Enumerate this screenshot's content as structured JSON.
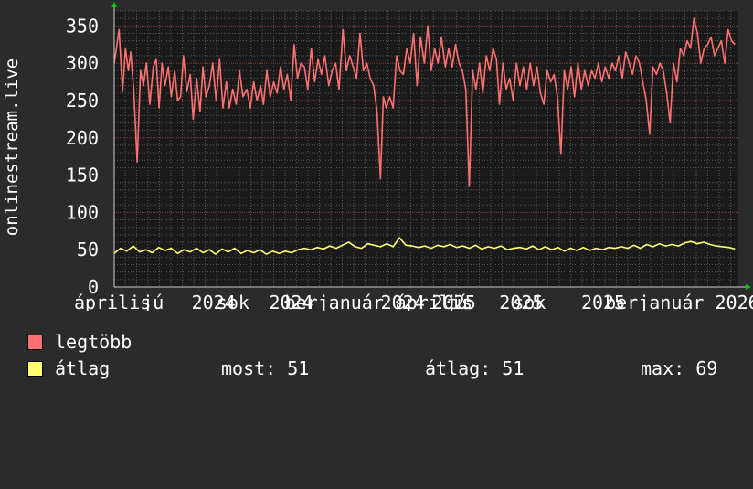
{
  "chart_data": {
    "type": "line",
    "ylabel": "onlinestream.live",
    "ylim": [
      0,
      370
    ],
    "yticks": [
      0,
      50,
      100,
      150,
      200,
      250,
      300,
      350
    ],
    "xticks": [
      {
        "t": 0.0,
        "label": "április"
      },
      {
        "t": 0.139,
        "label": "jú"
      },
      {
        "t": 0.241,
        "label": "2024"
      },
      {
        "t": 0.292,
        "label": "sok"
      },
      {
        "t": 0.4,
        "label": "2024"
      },
      {
        "t": 0.432,
        "label": "berjanuár"
      },
      {
        "t": 0.629,
        "label": "2024"
      },
      {
        "t": 0.659,
        "label": "április"
      },
      {
        "t": 0.734,
        "label": "2025"
      },
      {
        "t": 0.762,
        "label": "jú"
      },
      {
        "t": 0.872,
        "label": "2025"
      },
      {
        "t": 0.9,
        "label": "sok"
      },
      {
        "t": 1.04,
        "label": "2025"
      },
      {
        "t": 1.089,
        "label": "berjanuár 2026"
      }
    ],
    "grid": true,
    "series": [
      {
        "name": "legtöbb",
        "color": "#ff7070",
        "points": [
          [
            0.0,
            300
          ],
          [
            0.01,
            345
          ],
          [
            0.017,
            262
          ],
          [
            0.023,
            320
          ],
          [
            0.029,
            290
          ],
          [
            0.034,
            315
          ],
          [
            0.04,
            265
          ],
          [
            0.047,
            168
          ],
          [
            0.054,
            290
          ],
          [
            0.06,
            270
          ],
          [
            0.066,
            300
          ],
          [
            0.073,
            245
          ],
          [
            0.08,
            295
          ],
          [
            0.086,
            305
          ],
          [
            0.092,
            240
          ],
          [
            0.098,
            300
          ],
          [
            0.104,
            270
          ],
          [
            0.111,
            295
          ],
          [
            0.117,
            255
          ],
          [
            0.124,
            290
          ],
          [
            0.13,
            250
          ],
          [
            0.136,
            255
          ],
          [
            0.142,
            310
          ],
          [
            0.149,
            262
          ],
          [
            0.156,
            285
          ],
          [
            0.162,
            225
          ],
          [
            0.169,
            280
          ],
          [
            0.176,
            235
          ],
          [
            0.182,
            295
          ],
          [
            0.188,
            255
          ],
          [
            0.195,
            270
          ],
          [
            0.202,
            300
          ],
          [
            0.209,
            250
          ],
          [
            0.216,
            305
          ],
          [
            0.223,
            240
          ],
          [
            0.23,
            275
          ],
          [
            0.236,
            240
          ],
          [
            0.243,
            265
          ],
          [
            0.25,
            245
          ],
          [
            0.257,
            290
          ],
          [
            0.264,
            255
          ],
          [
            0.272,
            265
          ],
          [
            0.279,
            240
          ],
          [
            0.286,
            275
          ],
          [
            0.293,
            250
          ],
          [
            0.3,
            270
          ],
          [
            0.306,
            245
          ],
          [
            0.313,
            290
          ],
          [
            0.32,
            255
          ],
          [
            0.327,
            275
          ],
          [
            0.334,
            260
          ],
          [
            0.341,
            295
          ],
          [
            0.348,
            265
          ],
          [
            0.355,
            285
          ],
          [
            0.362,
            250
          ],
          [
            0.369,
            325
          ],
          [
            0.376,
            280
          ],
          [
            0.383,
            300
          ],
          [
            0.39,
            295
          ],
          [
            0.397,
            265
          ],
          [
            0.404,
            320
          ],
          [
            0.411,
            275
          ],
          [
            0.418,
            305
          ],
          [
            0.425,
            285
          ],
          [
            0.432,
            310
          ],
          [
            0.44,
            270
          ],
          [
            0.447,
            290
          ],
          [
            0.454,
            300
          ],
          [
            0.461,
            265
          ],
          [
            0.469,
            345
          ],
          [
            0.476,
            290
          ],
          [
            0.483,
            310
          ],
          [
            0.49,
            295
          ],
          [
            0.497,
            280
          ],
          [
            0.504,
            340
          ],
          [
            0.511,
            290
          ],
          [
            0.518,
            300
          ],
          [
            0.525,
            280
          ],
          [
            0.532,
            270
          ],
          [
            0.539,
            235
          ],
          [
            0.546,
            145
          ],
          [
            0.552,
            255
          ],
          [
            0.558,
            240
          ],
          [
            0.565,
            255
          ],
          [
            0.572,
            240
          ],
          [
            0.579,
            310
          ],
          [
            0.586,
            290
          ],
          [
            0.593,
            285
          ],
          [
            0.6,
            320
          ],
          [
            0.607,
            300
          ],
          [
            0.614,
            340
          ],
          [
            0.621,
            270
          ],
          [
            0.628,
            335
          ],
          [
            0.636,
            300
          ],
          [
            0.643,
            350
          ],
          [
            0.65,
            290
          ],
          [
            0.657,
            320
          ],
          [
            0.664,
            300
          ],
          [
            0.671,
            335
          ],
          [
            0.679,
            295
          ],
          [
            0.686,
            320
          ],
          [
            0.693,
            295
          ],
          [
            0.7,
            325
          ],
          [
            0.707,
            300
          ],
          [
            0.714,
            290
          ],
          [
            0.721,
            265
          ],
          [
            0.728,
            135
          ],
          [
            0.735,
            290
          ],
          [
            0.742,
            265
          ],
          [
            0.749,
            300
          ],
          [
            0.756,
            260
          ],
          [
            0.763,
            310
          ],
          [
            0.77,
            290
          ],
          [
            0.777,
            320
          ],
          [
            0.784,
            305
          ],
          [
            0.79,
            245
          ],
          [
            0.797,
            300
          ],
          [
            0.804,
            265
          ],
          [
            0.811,
            280
          ],
          [
            0.818,
            250
          ],
          [
            0.825,
            300
          ],
          [
            0.832,
            270
          ],
          [
            0.839,
            295
          ],
          [
            0.846,
            265
          ],
          [
            0.853,
            300
          ],
          [
            0.86,
            270
          ],
          [
            0.867,
            295
          ],
          [
            0.874,
            260
          ],
          [
            0.881,
            245
          ],
          [
            0.888,
            290
          ],
          [
            0.895,
            275
          ],
          [
            0.902,
            285
          ],
          [
            0.909,
            255
          ],
          [
            0.916,
            178
          ],
          [
            0.923,
            290
          ],
          [
            0.93,
            265
          ],
          [
            0.937,
            295
          ],
          [
            0.944,
            255
          ],
          [
            0.951,
            300
          ],
          [
            0.958,
            265
          ],
          [
            0.965,
            290
          ],
          [
            0.972,
            270
          ],
          [
            0.979,
            290
          ],
          [
            0.986,
            280
          ],
          [
            0.993,
            300
          ],
          [
            1.0,
            275
          ],
          [
            1.007,
            295
          ],
          [
            1.014,
            280
          ],
          [
            1.021,
            300
          ],
          [
            1.028,
            290
          ],
          [
            1.035,
            310
          ],
          [
            1.042,
            280
          ],
          [
            1.049,
            315
          ],
          [
            1.056,
            300
          ],
          [
            1.063,
            285
          ],
          [
            1.07,
            310
          ],
          [
            1.077,
            300
          ],
          [
            1.084,
            275
          ],
          [
            1.091,
            250
          ],
          [
            1.098,
            205
          ],
          [
            1.105,
            295
          ],
          [
            1.112,
            285
          ],
          [
            1.119,
            300
          ],
          [
            1.126,
            290
          ],
          [
            1.133,
            260
          ],
          [
            1.14,
            220
          ],
          [
            1.147,
            300
          ],
          [
            1.154,
            275
          ],
          [
            1.161,
            320
          ],
          [
            1.168,
            310
          ],
          [
            1.175,
            330
          ],
          [
            1.182,
            320
          ],
          [
            1.189,
            360
          ],
          [
            1.196,
            340
          ],
          [
            1.203,
            300
          ],
          [
            1.21,
            320
          ],
          [
            1.217,
            325
          ],
          [
            1.224,
            335
          ],
          [
            1.231,
            310
          ],
          [
            1.238,
            320
          ],
          [
            1.245,
            330
          ],
          [
            1.252,
            300
          ],
          [
            1.259,
            345
          ],
          [
            1.266,
            330
          ],
          [
            1.273,
            325
          ]
        ]
      },
      {
        "name": "átlag",
        "color": "#ffff70",
        "points": [
          [
            0.0,
            45
          ],
          [
            0.013,
            52
          ],
          [
            0.026,
            48
          ],
          [
            0.039,
            55
          ],
          [
            0.052,
            47
          ],
          [
            0.065,
            50
          ],
          [
            0.078,
            46
          ],
          [
            0.091,
            53
          ],
          [
            0.104,
            49
          ],
          [
            0.117,
            52
          ],
          [
            0.13,
            45
          ],
          [
            0.143,
            50
          ],
          [
            0.156,
            47
          ],
          [
            0.169,
            52
          ],
          [
            0.182,
            46
          ],
          [
            0.195,
            50
          ],
          [
            0.208,
            44
          ],
          [
            0.221,
            51
          ],
          [
            0.234,
            47
          ],
          [
            0.247,
            52
          ],
          [
            0.26,
            45
          ],
          [
            0.273,
            49
          ],
          [
            0.286,
            46
          ],
          [
            0.299,
            50
          ],
          [
            0.312,
            44
          ],
          [
            0.325,
            48
          ],
          [
            0.338,
            45
          ],
          [
            0.351,
            48
          ],
          [
            0.364,
            46
          ],
          [
            0.377,
            50
          ],
          [
            0.39,
            52
          ],
          [
            0.403,
            50
          ],
          [
            0.416,
            53
          ],
          [
            0.429,
            51
          ],
          [
            0.442,
            55
          ],
          [
            0.455,
            52
          ],
          [
            0.468,
            56
          ],
          [
            0.481,
            60
          ],
          [
            0.494,
            54
          ],
          [
            0.507,
            52
          ],
          [
            0.52,
            58
          ],
          [
            0.533,
            56
          ],
          [
            0.546,
            54
          ],
          [
            0.559,
            58
          ],
          [
            0.572,
            54
          ],
          [
            0.585,
            66
          ],
          [
            0.598,
            56
          ],
          [
            0.611,
            55
          ],
          [
            0.624,
            53
          ],
          [
            0.637,
            55
          ],
          [
            0.65,
            52
          ],
          [
            0.663,
            56
          ],
          [
            0.676,
            54
          ],
          [
            0.689,
            57
          ],
          [
            0.702,
            53
          ],
          [
            0.715,
            55
          ],
          [
            0.728,
            52
          ],
          [
            0.741,
            56
          ],
          [
            0.754,
            51
          ],
          [
            0.767,
            54
          ],
          [
            0.78,
            52
          ],
          [
            0.793,
            55
          ],
          [
            0.806,
            50
          ],
          [
            0.819,
            52
          ],
          [
            0.832,
            53
          ],
          [
            0.845,
            51
          ],
          [
            0.858,
            55
          ],
          [
            0.871,
            50
          ],
          [
            0.884,
            54
          ],
          [
            0.897,
            50
          ],
          [
            0.91,
            53
          ],
          [
            0.923,
            48
          ],
          [
            0.936,
            52
          ],
          [
            0.949,
            49
          ],
          [
            0.962,
            53
          ],
          [
            0.975,
            49
          ],
          [
            0.988,
            52
          ],
          [
            1.001,
            50
          ],
          [
            1.014,
            53
          ],
          [
            1.027,
            52
          ],
          [
            1.04,
            54
          ],
          [
            1.053,
            52
          ],
          [
            1.066,
            56
          ],
          [
            1.079,
            52
          ],
          [
            1.092,
            57
          ],
          [
            1.105,
            54
          ],
          [
            1.118,
            58
          ],
          [
            1.131,
            55
          ],
          [
            1.144,
            57
          ],
          [
            1.157,
            55
          ],
          [
            1.17,
            59
          ],
          [
            1.183,
            61
          ],
          [
            1.196,
            58
          ],
          [
            1.209,
            60
          ],
          [
            1.222,
            57
          ],
          [
            1.235,
            55
          ],
          [
            1.248,
            54
          ],
          [
            1.261,
            53
          ],
          [
            1.273,
            51
          ]
        ]
      }
    ]
  },
  "legend": {
    "series1": "legtöbb",
    "series2": "átlag",
    "stat_now": "most: 51",
    "stat_avg": "átlag: 51",
    "stat_max": "max: 69"
  },
  "colors": {
    "bg": "#2b2b2b",
    "plot_bg": "#1a1a1a",
    "grid": "#575757",
    "axis_arrow": "#00cc00"
  }
}
